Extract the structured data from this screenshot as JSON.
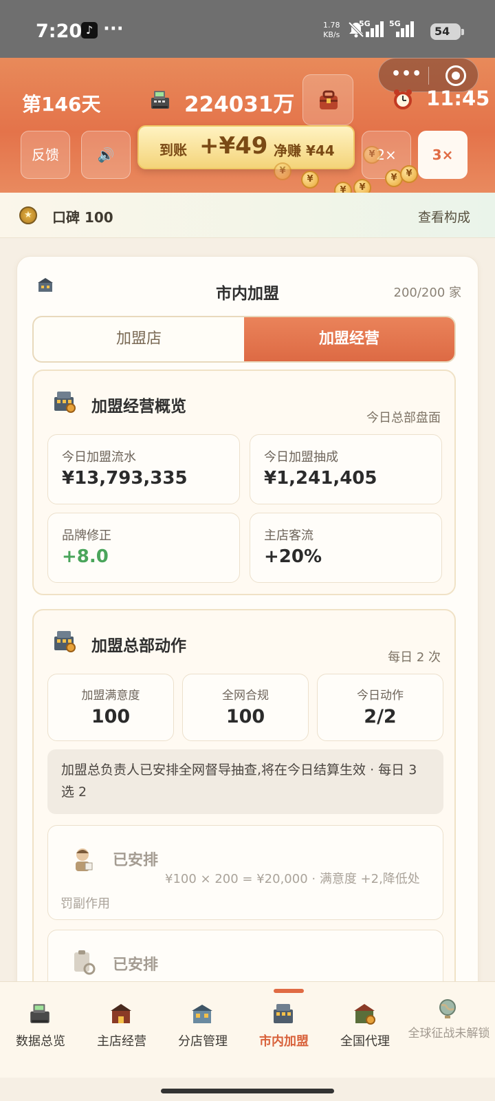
{
  "status_bar": {
    "time": "7:20",
    "dots": "···",
    "net_speed": "1.78",
    "net_unit": "KB/s",
    "signal1_label": "5G",
    "signal2_label": "5G",
    "battery": "54"
  },
  "header": {
    "day": "第146天",
    "money": "224031万",
    "clock": "11:45",
    "buttons": {
      "feedback": "反馈",
      "sound": "🔊",
      "speed_2x": "2×",
      "speed_3x": "3×"
    },
    "toast": {
      "arrived": "到账",
      "amount": "+¥49",
      "net": "净赚 ¥44"
    }
  },
  "reputation": {
    "label": "口碑 100",
    "link": "查看构成"
  },
  "main": {
    "title": "市内加盟",
    "count": "200/200 家",
    "tabs": {
      "left": "加盟店",
      "right": "加盟经营"
    },
    "overview": {
      "title": "加盟经营概览",
      "subtitle": "今日总部盘面",
      "stats": [
        {
          "label": "今日加盟流水",
          "value": "¥13,793,335"
        },
        {
          "label": "今日加盟抽成",
          "value": "¥1,241,405"
        },
        {
          "label": "品牌修正",
          "value": "+8.0"
        },
        {
          "label": "主店客流",
          "value": "+20%"
        }
      ]
    },
    "actions": {
      "title": "加盟总部动作",
      "subtitle": "每日 2 次",
      "minis": [
        {
          "label": "加盟满意度",
          "value": "100"
        },
        {
          "label": "全网合规",
          "value": "100"
        },
        {
          "label": "今日动作",
          "value": "2/2"
        }
      ],
      "notice": "加盟总负责人已安排全网督导抽查,将在今日结算生效 · 每日 3 选 2",
      "items": [
        {
          "status": "已安排",
          "desc": "¥100 × 200 = ¥20,000 · 满意度 +2,降低处罚副作用"
        },
        {
          "status": "已安排"
        }
      ]
    }
  },
  "bottom_nav": {
    "items": [
      {
        "label": "数据总览"
      },
      {
        "label": "主店经营"
      },
      {
        "label": "分店管理"
      },
      {
        "label": "市内加盟"
      },
      {
        "label": "全国代理"
      },
      {
        "label": "全球征战未解锁"
      }
    ]
  },
  "colors": {
    "accent": "#e06b44",
    "positive": "#4aa55b",
    "header_gradient_top": "#e88a5a"
  }
}
